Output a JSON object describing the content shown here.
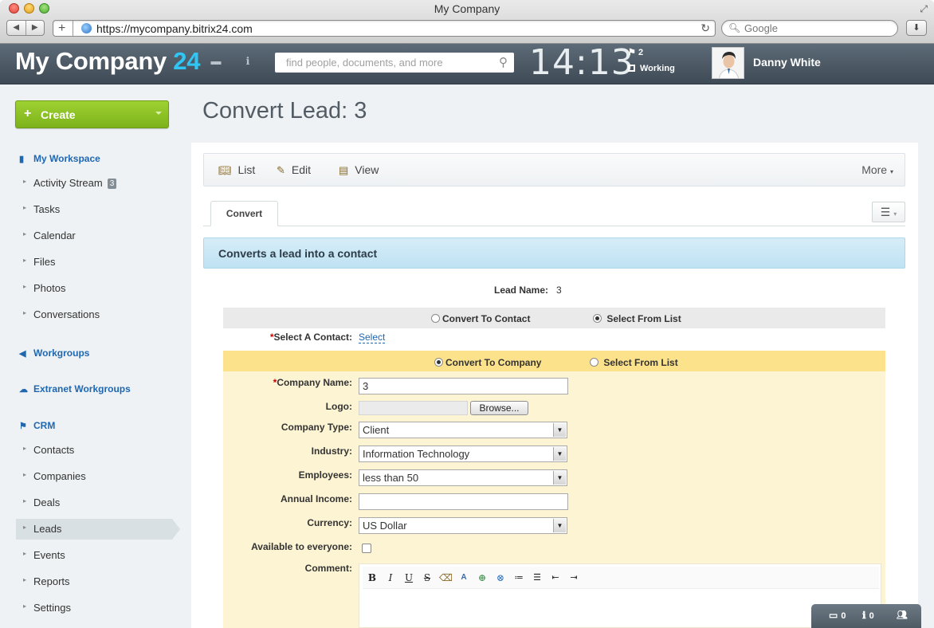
{
  "browser": {
    "window_title": "My Company",
    "url": "https://mycompany.bitrix24.com",
    "search_placeholder": "Google"
  },
  "header": {
    "logo_text": "My Company",
    "logo_number": "24",
    "search_placeholder": "find people, documents, and more",
    "clock": "14:13",
    "flag_count": "2",
    "work_status": "Working",
    "user_name": "Danny White"
  },
  "sidebar": {
    "create_label": "Create",
    "workspace_label": "My Workspace",
    "workspace_items": [
      {
        "label": "Activity Stream",
        "counter": "3"
      },
      {
        "label": "Tasks"
      },
      {
        "label": "Calendar"
      },
      {
        "label": "Files"
      },
      {
        "label": "Photos"
      },
      {
        "label": "Conversations"
      }
    ],
    "workgroups_label": "Workgroups",
    "extranet_label": "Extranet Workgroups",
    "crm_label": "CRM",
    "crm_items": [
      {
        "label": "Contacts"
      },
      {
        "label": "Companies"
      },
      {
        "label": "Deals"
      },
      {
        "label": "Leads",
        "active": true
      },
      {
        "label": "Events"
      },
      {
        "label": "Reports"
      },
      {
        "label": "Settings"
      }
    ]
  },
  "main": {
    "page_title": "Convert Lead: 3",
    "toolbar": {
      "list": "List",
      "edit": "Edit",
      "view": "View",
      "more": "More"
    },
    "tab_label": "Convert",
    "banner": "Converts a lead into a contact",
    "lead_name_label": "Lead Name:",
    "lead_name_value": "3",
    "contact_options": {
      "convert": "Convert To Contact",
      "select": "Select From List",
      "selected": "select"
    },
    "select_contact_label": "Select A Contact:",
    "select_contact_link": "Select",
    "company_options": {
      "convert": "Convert To Company",
      "select": "Select From List",
      "selected": "convert"
    },
    "fields": {
      "company_name_label": "Company Name:",
      "company_name_value": "3",
      "logo_label": "Logo:",
      "browse_label": "Browse...",
      "company_type_label": "Company Type:",
      "company_type_value": "Client",
      "industry_label": "Industry:",
      "industry_value": "Information Technology",
      "employees_label": "Employees:",
      "employees_value": "less than 50",
      "annual_income_label": "Annual Income:",
      "annual_income_value": "",
      "currency_label": "Currency:",
      "currency_value": "US Dollar",
      "available_label": "Available to everyone:",
      "available_checked": false,
      "comment_label": "Comment:"
    }
  },
  "status_widget": {
    "messages": "0",
    "notifications": "0"
  }
}
